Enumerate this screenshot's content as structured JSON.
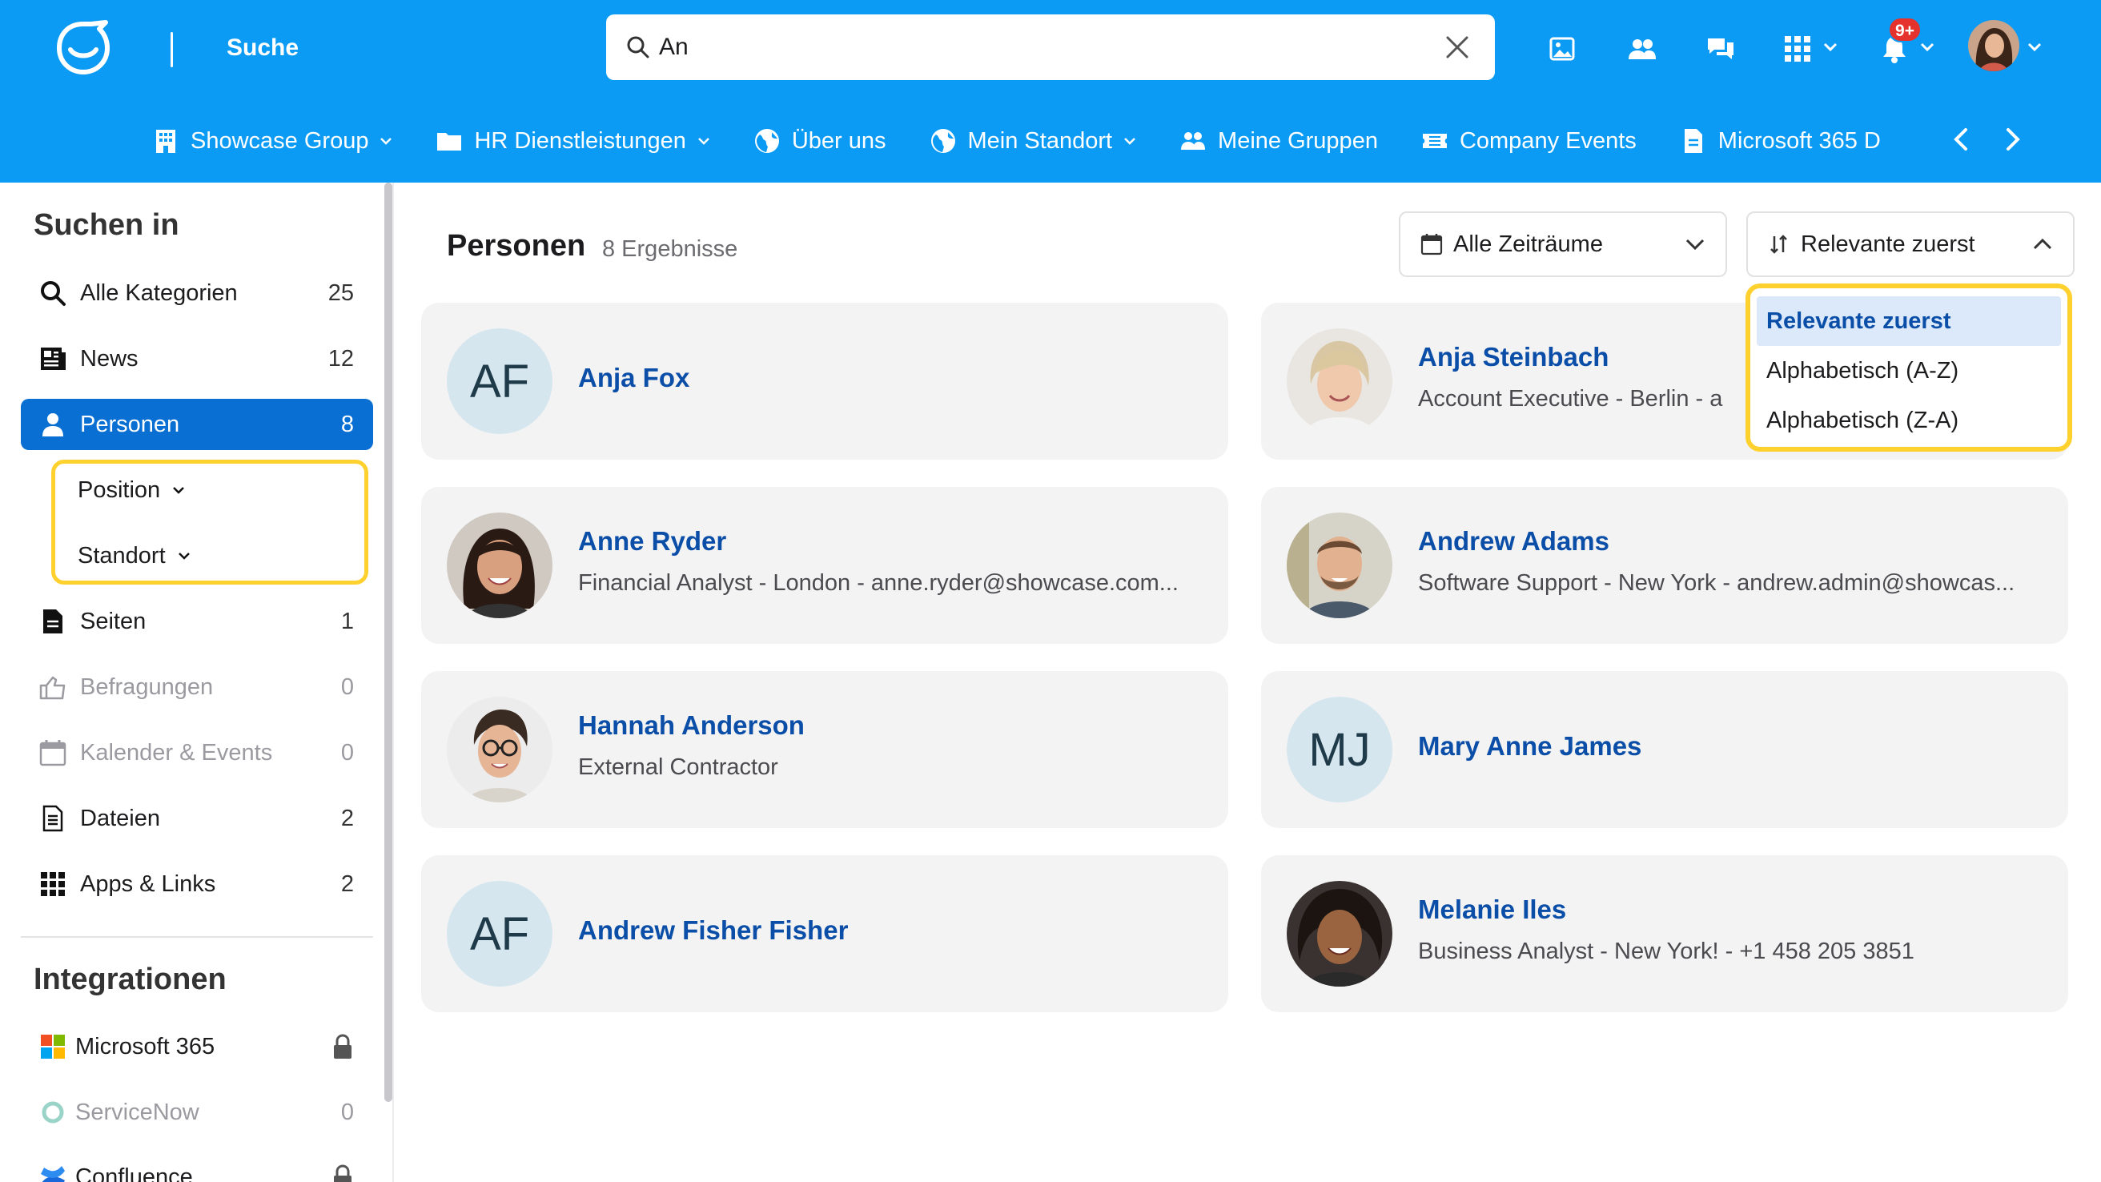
{
  "header": {
    "title": "Suche",
    "search": {
      "value": "An",
      "placeholder": ""
    },
    "notification_badge": "9+",
    "icons": [
      "image-icon",
      "people-icon",
      "chat-icon",
      "apps-grid-icon",
      "bell-icon"
    ],
    "brand_color": "#0b9bf5"
  },
  "nav": {
    "items": [
      {
        "label": "Showcase Group",
        "icon": "building-icon",
        "dropdown": true
      },
      {
        "label": "HR Dienstleistungen",
        "icon": "folder-icon",
        "dropdown": true
      },
      {
        "label": "Über uns",
        "icon": "globe-icon",
        "dropdown": false
      },
      {
        "label": "Mein Standort",
        "icon": "globe-icon",
        "dropdown": true
      },
      {
        "label": "Meine Gruppen",
        "icon": "people-icon",
        "dropdown": false
      },
      {
        "label": "Company Events",
        "icon": "ticket-icon",
        "dropdown": false
      },
      {
        "label": "Microsoft 365 D",
        "icon": "document-icon",
        "dropdown": false
      }
    ]
  },
  "sidebar": {
    "heading": "Suchen in",
    "items": [
      {
        "label": "Alle Kategorien",
        "count": "25",
        "icon": "search-icon"
      },
      {
        "label": "News",
        "count": "12",
        "icon": "news-icon"
      },
      {
        "label": "Personen",
        "count": "8",
        "icon": "person-icon"
      },
      {
        "label": "Seiten",
        "count": "1",
        "icon": "page-icon"
      },
      {
        "label": "Befragungen",
        "count": "0",
        "icon": "survey-icon"
      },
      {
        "label": "Kalender & Events",
        "count": "0",
        "icon": "calendar-icon"
      },
      {
        "label": "Dateien",
        "count": "2",
        "icon": "file-icon"
      },
      {
        "label": "Apps & Links",
        "count": "2",
        "icon": "apps-grid-icon"
      }
    ],
    "filters": [
      {
        "label": "Position"
      },
      {
        "label": "Standort"
      }
    ],
    "integrations_heading": "Integrationen",
    "integrations": [
      {
        "label": "Microsoft 365",
        "status": "locked"
      },
      {
        "label": "ServiceNow",
        "count": "0"
      },
      {
        "label": "Confluence",
        "status": "locked"
      }
    ]
  },
  "main": {
    "title": "Personen",
    "count_label": "8 Ergebnisse",
    "time_filter": "Alle Zeiträume",
    "sort": {
      "selected": "Relevante zuerst",
      "options": [
        "Relevante zuerst",
        "Alphabetisch (A-Z)",
        "Alphabetisch (Z-A)"
      ]
    },
    "people": [
      {
        "name": "Anja Fox",
        "subtitle": "",
        "initials": "AF"
      },
      {
        "name": "Anja Steinbach",
        "subtitle": "Account Executive - Berlin - a",
        "initials": ""
      },
      {
        "name": "Anne Ryder",
        "subtitle": "Financial Analyst - London - anne.ryder@showcase.com...",
        "initials": ""
      },
      {
        "name": "Andrew Adams",
        "subtitle": "Software Support - New York - andrew.admin@showcas...",
        "initials": ""
      },
      {
        "name": "Hannah Anderson",
        "subtitle": "External Contractor",
        "initials": ""
      },
      {
        "name": "Mary Anne James",
        "subtitle": "",
        "initials": "MJ"
      },
      {
        "name": "Andrew Fisher Fisher",
        "subtitle": "",
        "initials": "AF"
      },
      {
        "name": "Melanie Iles",
        "subtitle": "Business Analyst - New York! - +1 458 205 3851",
        "initials": ""
      }
    ]
  }
}
